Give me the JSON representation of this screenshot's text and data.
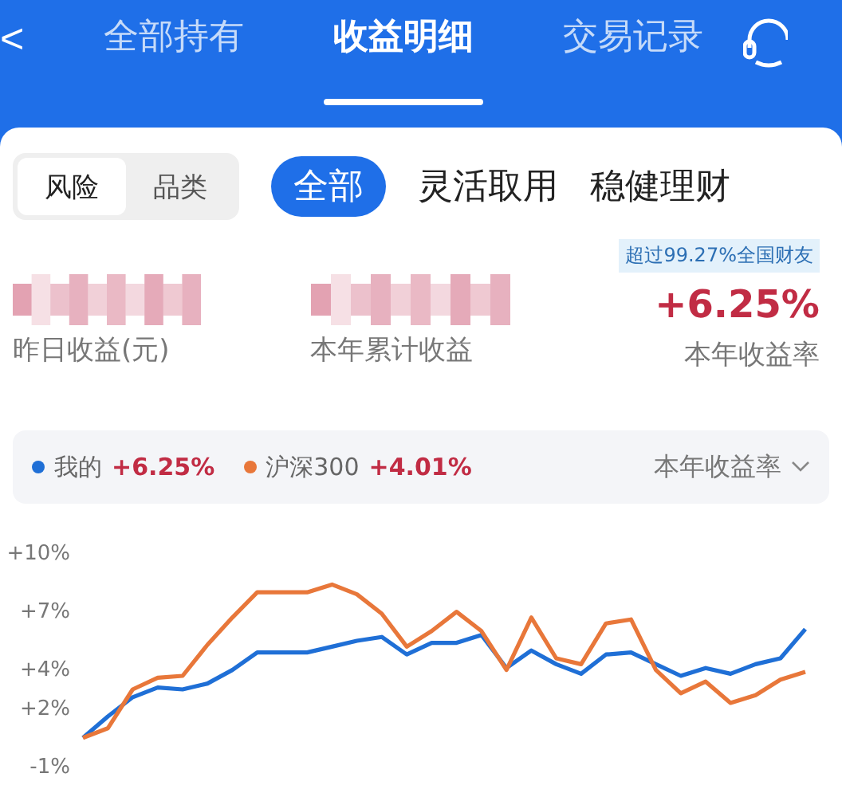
{
  "header": {
    "back": "<",
    "tabs": [
      {
        "label": "全部持有",
        "selected": false
      },
      {
        "label": "收益明细",
        "selected": true
      },
      {
        "label": "交易记录",
        "selected": false
      }
    ]
  },
  "segment": [
    {
      "label": "风险",
      "selected": true
    },
    {
      "label": "品类",
      "selected": false
    }
  ],
  "categories": [
    {
      "label": "全部",
      "selected": true
    },
    {
      "label": "灵活取用",
      "selected": false
    },
    {
      "label": "稳健理财",
      "selected": false
    }
  ],
  "stats": [
    {
      "label": "昨日收益(元)"
    },
    {
      "label": "本年累计收益"
    },
    {
      "label": "本年收益率",
      "value": "+6.25%",
      "badge": "超过99.27%全国财友"
    }
  ],
  "legend": [
    {
      "value": "+6.25%"
    },
    {
      "value": "+4.01%"
    }
  ],
  "period": "本年收益率",
  "chart_data": {
    "type": "line",
    "ylim": [
      -1,
      10
    ],
    "yticks": [
      {
        "value": 10,
        "label": "+10%"
      },
      {
        "value": 7,
        "label": "+7%"
      },
      {
        "value": 4,
        "label": "+4%"
      },
      {
        "value": 2,
        "label": "+2%"
      },
      {
        "value": -1,
        "label": "-1%"
      }
    ],
    "series": [
      {
        "name": "我的",
        "color": "#1f6fd6",
        "values": [
          0.4,
          1.5,
          2.5,
          3.0,
          2.9,
          3.2,
          3.9,
          4.8,
          4.8,
          4.8,
          5.1,
          5.4,
          5.6,
          4.7,
          5.3,
          5.3,
          5.7,
          4.0,
          4.9,
          4.2,
          3.7,
          4.7,
          4.8,
          4.2,
          3.6,
          4.0,
          3.7,
          4.2,
          4.5,
          6.0
        ]
      },
      {
        "name": "沪深300",
        "color": "#e8773a",
        "values": [
          0.4,
          0.9,
          2.9,
          3.5,
          3.6,
          5.2,
          6.6,
          7.9,
          7.9,
          7.9,
          8.3,
          7.8,
          6.8,
          5.1,
          5.9,
          6.9,
          5.9,
          3.9,
          6.6,
          4.5,
          4.2,
          6.3,
          6.5,
          3.9,
          2.7,
          3.3,
          2.2,
          2.6,
          3.4,
          3.8
        ]
      }
    ]
  }
}
